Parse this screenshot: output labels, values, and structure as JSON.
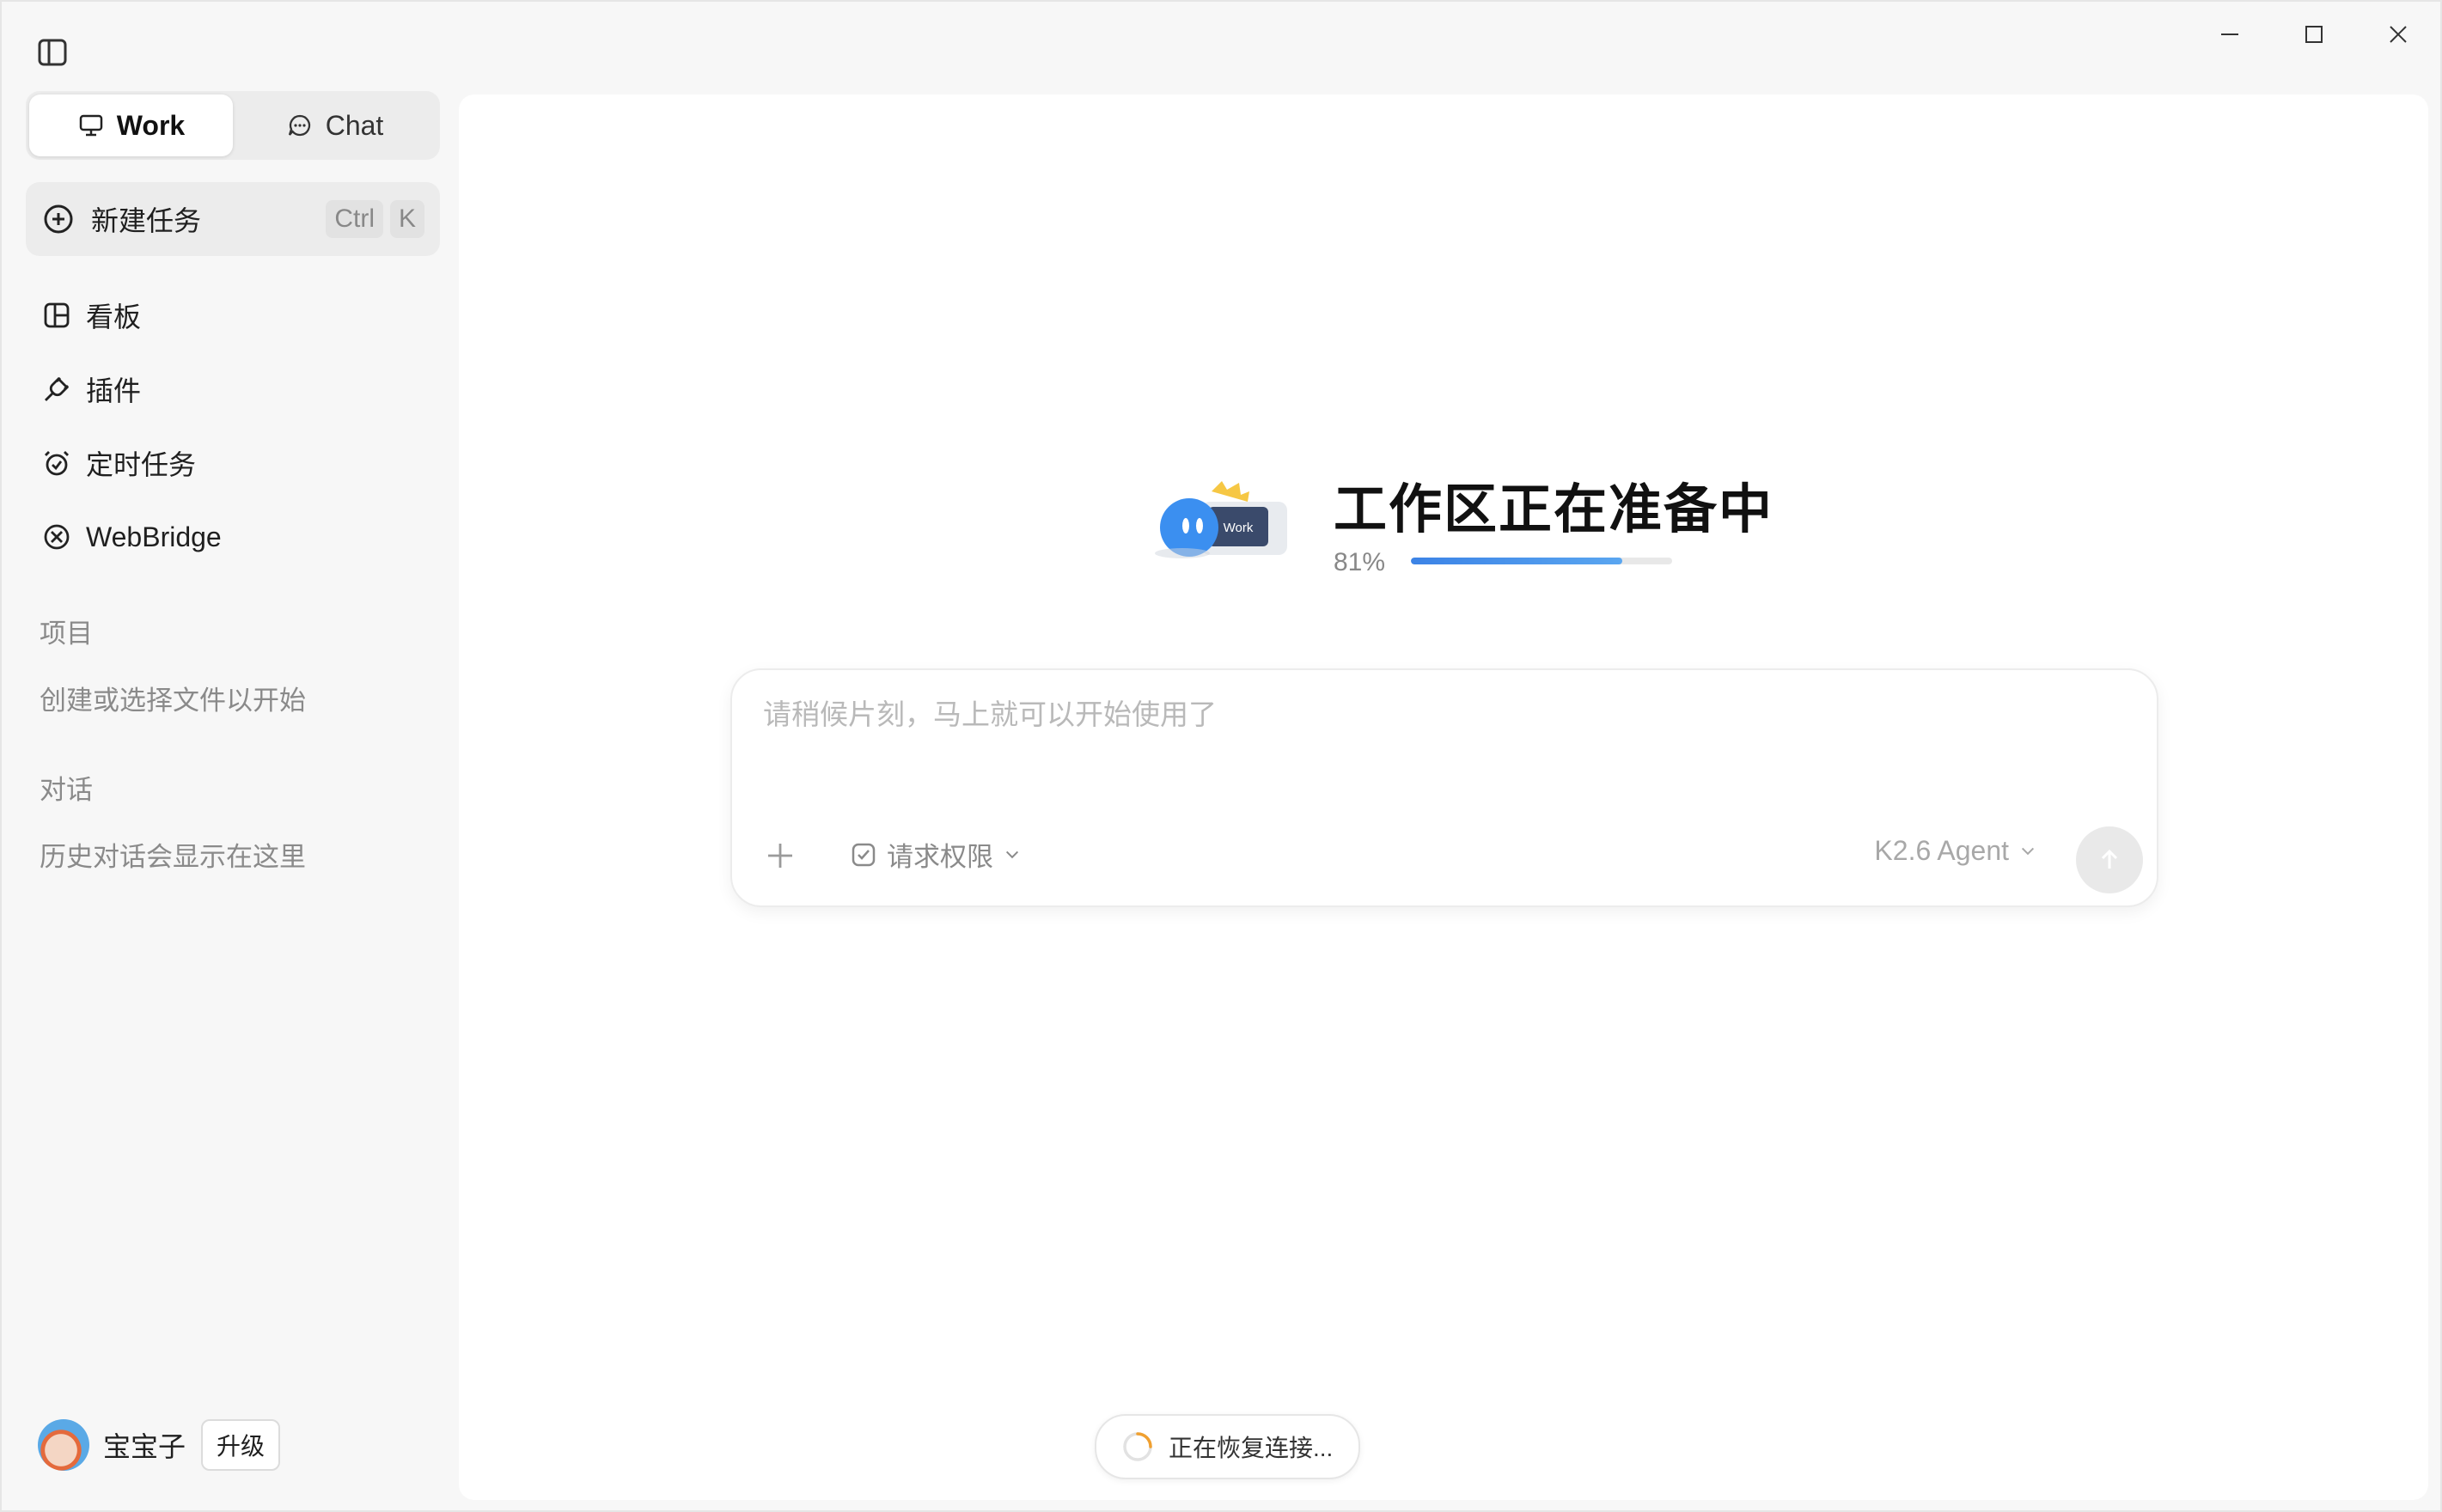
{
  "window": {
    "minimize_icon": "minimize-icon",
    "maximize_icon": "maximize-icon",
    "close_icon": "close-icon"
  },
  "sidebar": {
    "toggle_icon": "sidebar-toggle-icon",
    "mode_tabs": [
      {
        "label": "Work",
        "icon": "monitor-icon",
        "active": true
      },
      {
        "label": "Chat",
        "icon": "chat-bubble-icon",
        "active": false
      }
    ],
    "new_task": {
      "label": "新建任务",
      "shortcut": [
        "Ctrl",
        "K"
      ],
      "icon": "plus-circle-icon"
    },
    "nav_items": [
      {
        "label": "看板",
        "icon": "board-icon"
      },
      {
        "label": "插件",
        "icon": "plug-icon"
      },
      {
        "label": "定时任务",
        "icon": "alarm-clock-icon"
      },
      {
        "label": "WebBridge",
        "icon": "webbridge-icon"
      }
    ],
    "projects": {
      "title": "项目",
      "empty_hint": "创建或选择文件以开始"
    },
    "conversations": {
      "title": "对话",
      "empty_hint": "历史对话会显示在这里"
    },
    "user": {
      "name": "宝宝子",
      "upgrade_label": "升级"
    }
  },
  "main": {
    "status": {
      "title": "工作区正在准备中",
      "progress_text": "81%",
      "progress_value": 0.81,
      "illustration_text": "Work"
    },
    "composer": {
      "placeholder": "请稍候片刻，马上就可以开始使用了",
      "value": "",
      "permission_label": "请求权限",
      "model_label": "K2.6 Agent"
    },
    "toast": {
      "text": "正在恢复连接..."
    }
  },
  "colors": {
    "accent": "#3c83e6",
    "background": "#f7f7f7",
    "surface": "#ffffff"
  }
}
